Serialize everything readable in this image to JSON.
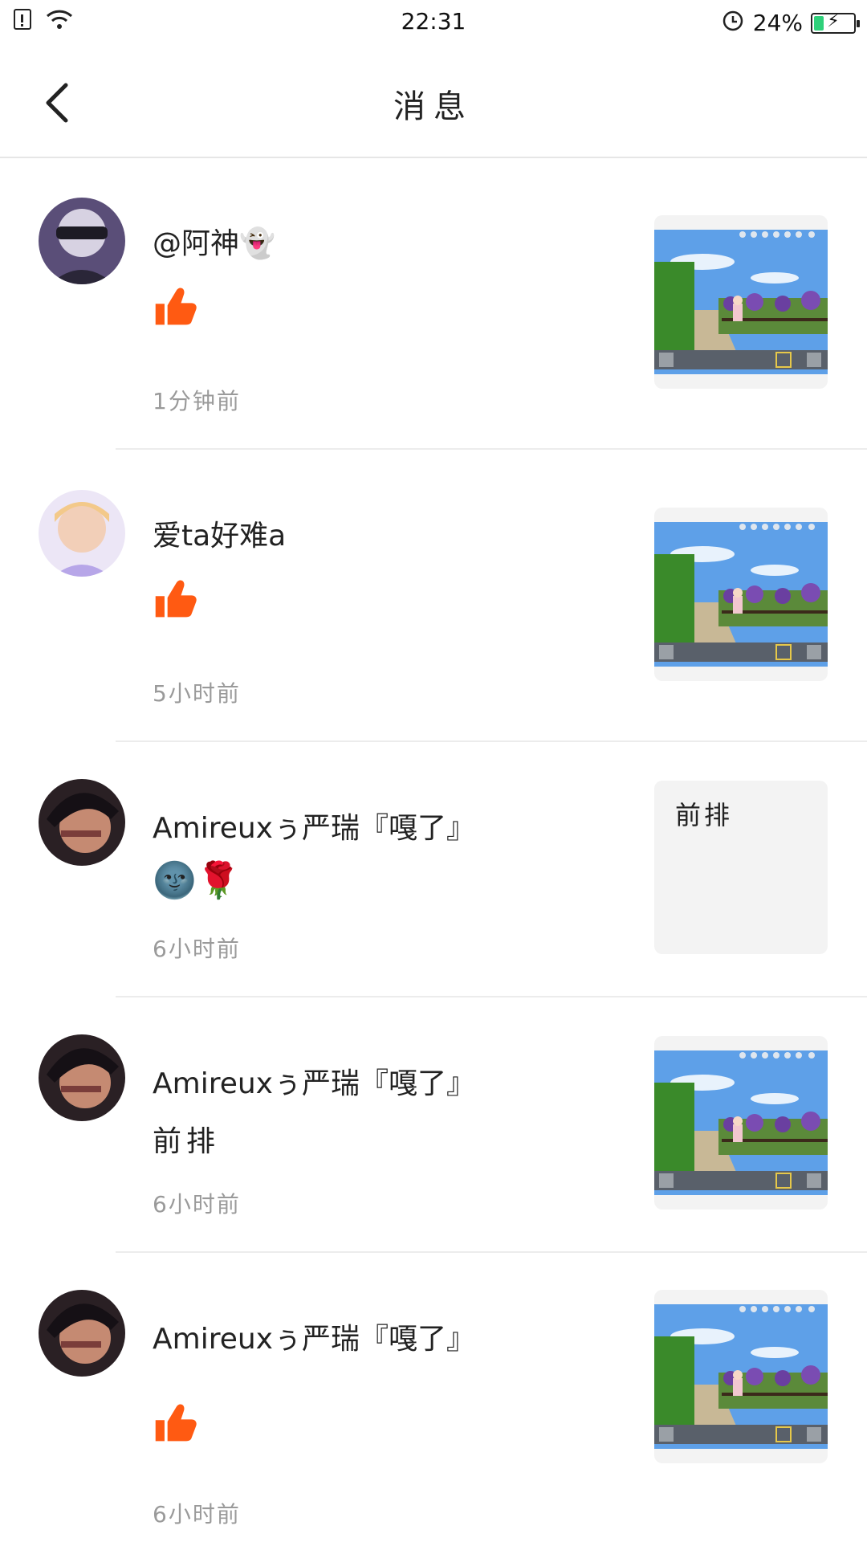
{
  "status_bar": {
    "time": "22:31",
    "battery": "24%",
    "battery_level": 0.24,
    "icons": [
      "sim-icon",
      "wifi-icon",
      "alarm-icon",
      "battery-icon"
    ]
  },
  "header": {
    "title": "消息"
  },
  "colors": {
    "like": "#ff5a12",
    "divider": "#ececec",
    "time_text": "#9a9a9a"
  },
  "messages": [
    {
      "name": "@阿神👻",
      "kind": "like",
      "content": "",
      "time": "1分钟前",
      "thumb_text": ""
    },
    {
      "name": "爱ta好难a",
      "kind": "like",
      "content": "",
      "time": "5小时前",
      "thumb_text": ""
    },
    {
      "name": "Amireuxぅ严瑞『嘎了』",
      "kind": "comment",
      "content": "🌚🌹",
      "time": "6小时前",
      "thumb_text": "前排"
    },
    {
      "name": "Amireuxぅ严瑞『嘎了』",
      "kind": "comment",
      "content": "前排",
      "time": "6小时前",
      "thumb_text": ""
    },
    {
      "name": "Amireuxぅ严瑞『嘎了』",
      "kind": "like",
      "content": "",
      "time": "6小时前",
      "thumb_text": ""
    }
  ]
}
